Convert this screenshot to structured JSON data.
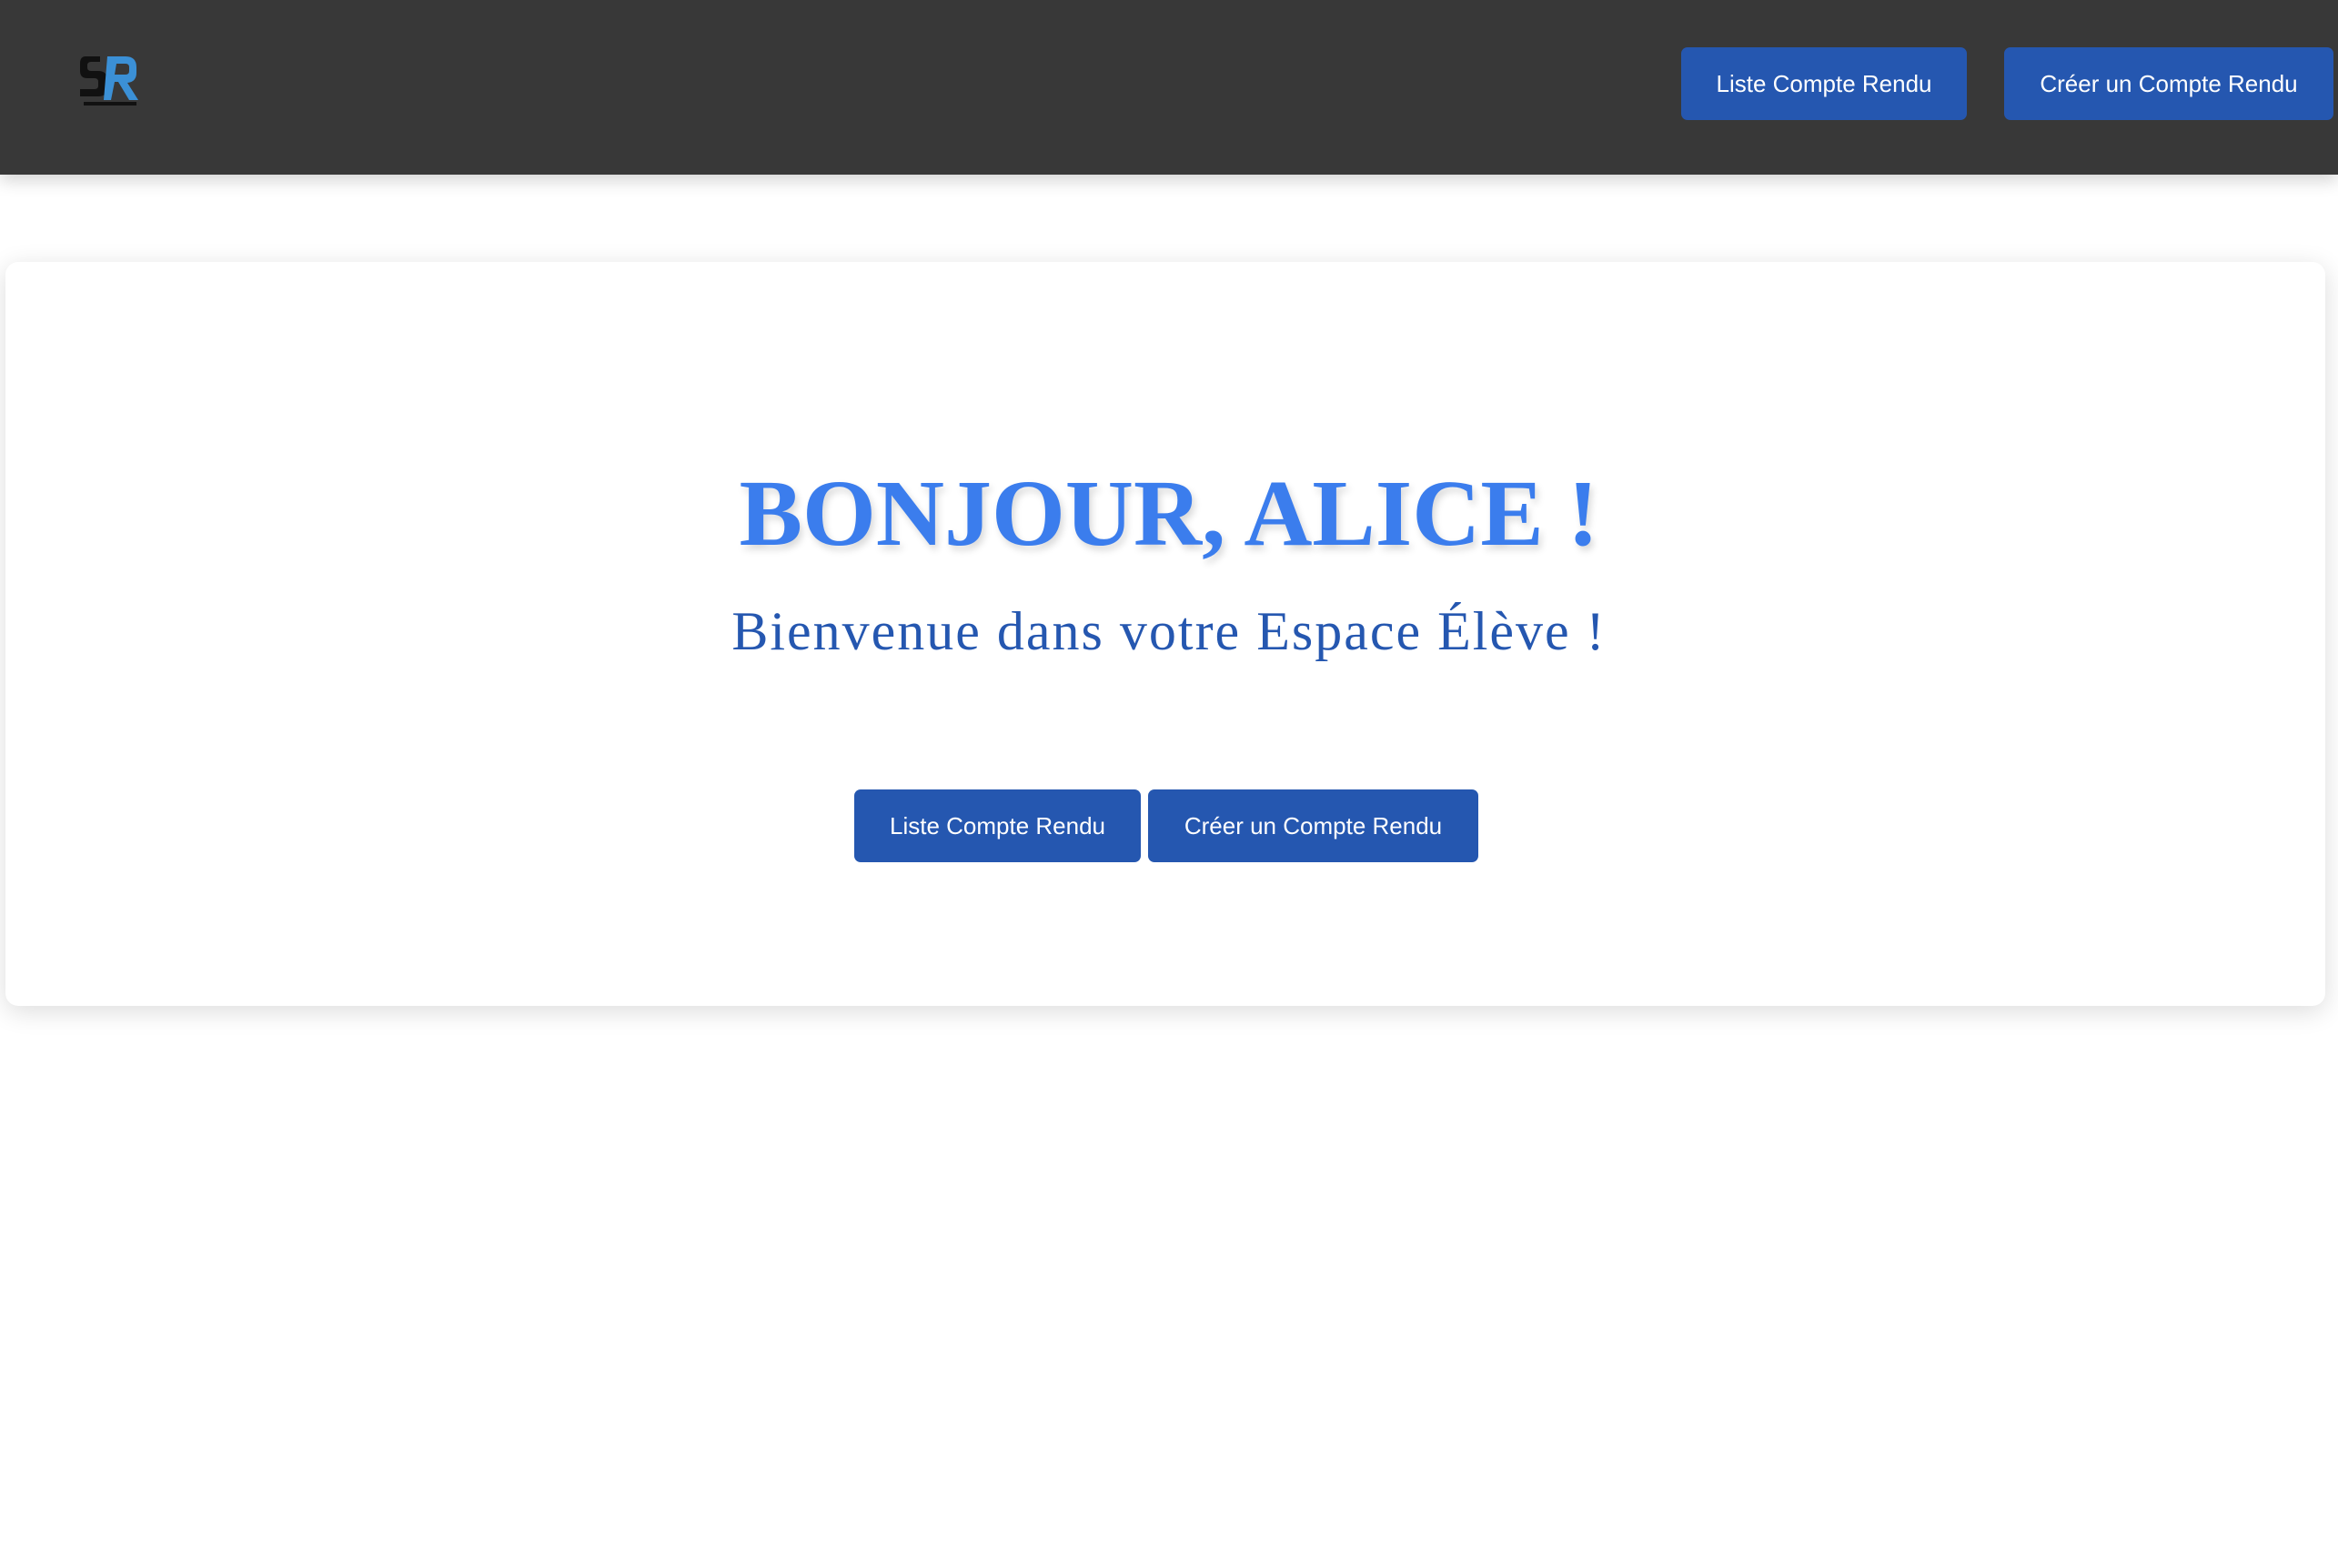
{
  "header": {
    "logo_icon": "stagereport-logo-icon",
    "nav": {
      "list_label": "Liste Compte Rendu",
      "create_label": "Créer un Compte Rendu"
    }
  },
  "main": {
    "greeting": "BONJOUR, ALICE !",
    "welcome": "Bienvenue dans votre Espace Élève !",
    "actions": {
      "list_label": "Liste Compte Rendu",
      "create_label": "Créer un Compte Rendu"
    }
  },
  "colors": {
    "topbar": "#383838",
    "button": "#2557b0",
    "greeting": "#3b7ded",
    "welcome": "#2557b0"
  }
}
